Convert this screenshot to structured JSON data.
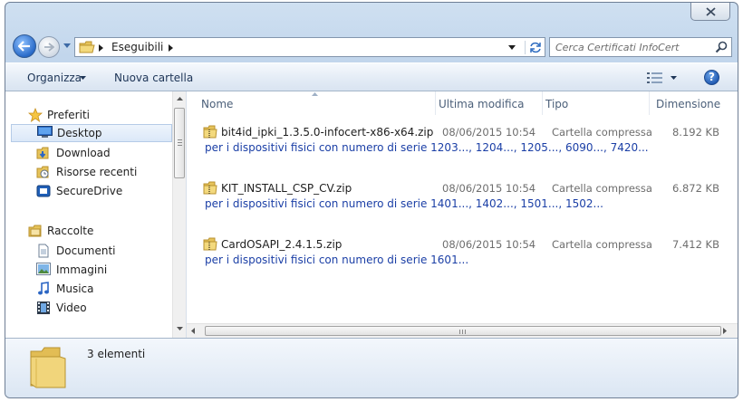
{
  "window": {
    "close_label": "close"
  },
  "address": {
    "crumbs": [
      "Eseguibili"
    ]
  },
  "search": {
    "placeholder": "Cerca Certificati InfoCert"
  },
  "toolbar": {
    "organize_label": "Organizza",
    "new_folder_label": "Nuova cartella",
    "help_label": "?"
  },
  "sidebar": {
    "favorites": {
      "label": "Preferiti",
      "items": [
        {
          "label": "Desktop",
          "icon": "desktop-icon",
          "selected": true
        },
        {
          "label": "Download",
          "icon": "download-icon",
          "selected": false
        },
        {
          "label": "Risorse recenti",
          "icon": "recent-places-icon",
          "selected": false
        },
        {
          "label": "SecureDrive",
          "icon": "securedrive-icon",
          "selected": false
        }
      ]
    },
    "libraries": {
      "label": "Raccolte",
      "items": [
        {
          "label": "Documenti",
          "icon": "documents-icon"
        },
        {
          "label": "Immagini",
          "icon": "pictures-icon"
        },
        {
          "label": "Musica",
          "icon": "music-icon"
        },
        {
          "label": "Video",
          "icon": "video-icon"
        }
      ]
    }
  },
  "columns": [
    "Nome",
    "Ultima modifica",
    "Tipo",
    "Dimensione"
  ],
  "files": [
    {
      "name": "bit4id_ipki_1.3.5.0-infocert-x86-x64.zip",
      "modified": "08/06/2015 10:54",
      "type": "Cartella compressa",
      "size": "8.192 KB",
      "description": "per i dispositivi fisici con numero di serie 1203..., 1204..., 1205..., 6090..., 7420..."
    },
    {
      "name": "KIT_INSTALL_CSP_CV.zip",
      "modified": "08/06/2015 10:54",
      "type": "Cartella compressa",
      "size": "6.872 KB",
      "description": "per i dispositivi fisici con numero di serie 1401..., 1402..., 1501..., 1502..."
    },
    {
      "name": "CardOSAPI_2.4.1.5.zip",
      "modified": "08/06/2015 10:54",
      "type": "Cartella compressa",
      "size": "7.412 KB",
      "description": "per i dispositivi fisici con numero di serie 1601..."
    }
  ],
  "details": {
    "item_count": "3 elementi"
  },
  "colors": {
    "link_blue": "#1b3fa6",
    "window_frame": "#c2d6ec",
    "selection": "#dbe8f8"
  }
}
